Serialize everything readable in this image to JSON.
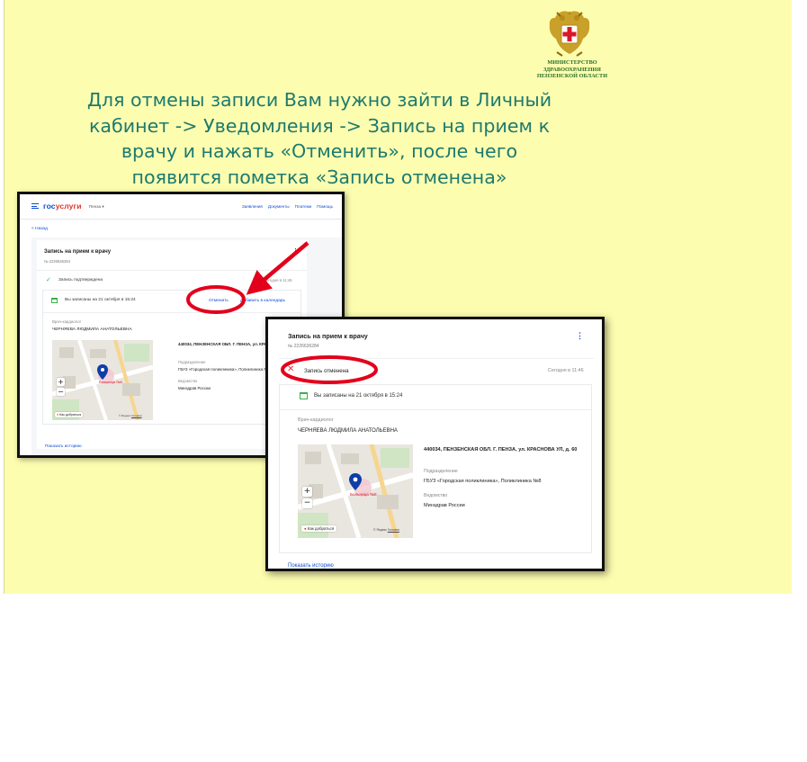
{
  "ministry": {
    "lines": [
      "МИНИСТЕРСТВО",
      "ЗДРАВООХРАНЕНИЯ",
      "ПЕНЗЕНСКОЙ ОБЛАСТИ"
    ]
  },
  "instruction": {
    "lines": [
      "Для отмены записи Вам нужно зайти в Личный",
      "кабинет -> Уведомления -> Запись на прием к",
      "врачу и нажать «Отменить», после чего",
      "появится пометка «Запись отменена»"
    ]
  },
  "colors": {
    "slide_background": "#fdfdb0",
    "heading": "#1d7a6e",
    "highlight_red": "#e3001b",
    "link_blue": "#0d4cd3"
  },
  "screenshot_before": {
    "header": {
      "logo_part1": "гос",
      "logo_part2": "услуги",
      "city": "Пенза",
      "nav": [
        "Заявления",
        "Документы",
        "Платежи",
        "Помощь"
      ]
    },
    "back_link": "< Назад",
    "title": "Запись на прием к врачу",
    "number": "№ 2226636284",
    "status": "Запись подтверждена",
    "status_time": "Сегодня в 11:45",
    "appointment": "Вы записаны на 21 октября в 15:24",
    "cancel_button": "Отменить",
    "add_calendar_button": "Добавить в календарь",
    "doctor_label": "Врач-кардиолог",
    "doctor_name": "ЧЕРНЯЕВА ЛЮДМИЛА АНАТОЛЬЕВНА",
    "address": "440034, ПЕНЗЕНСКАЯ ОБЛ. Г. ПЕНЗА, ул. КРАСНОВА УЛ, д. 60",
    "department_label": "Подразделение",
    "department": "ГБУЗ «Городская поликлиника», Поликлиника №8",
    "agency_label": "Ведомство",
    "agency": "Минздрав России",
    "map": {
      "route": "Как добраться",
      "copyright": "© Яндекс",
      "terms": "Условия",
      "label": "Больница №8"
    },
    "history_link": "Показать историю"
  },
  "screenshot_after": {
    "title": "Запись на прием к врачу",
    "number": "№ 2226636284",
    "status": "Запись отменена",
    "status_time": "Сегодня в 11:46",
    "appointment": "Вы записаны на 21 октября в 15:24",
    "doctor_label": "Врач-кардиолог",
    "doctor_name": "ЧЕРНЯЕВА ЛЮДМИЛА АНАТОЛЬЕВНА",
    "address": "440034, ПЕНЗЕНСКАЯ ОБЛ. Г. ПЕНЗА, ул. КРАСНОВА УЛ, д. 60",
    "department_label": "Подразделение",
    "department": "ГБУЗ «Городская поликлиника», Поликлиника №8",
    "agency_label": "Ведомство",
    "agency": "Минздрав России",
    "map": {
      "route": "Как добраться",
      "copyright": "© Яндекс",
      "terms": "Условия",
      "label": "Больница №8"
    },
    "history_link": "Показать историю"
  }
}
